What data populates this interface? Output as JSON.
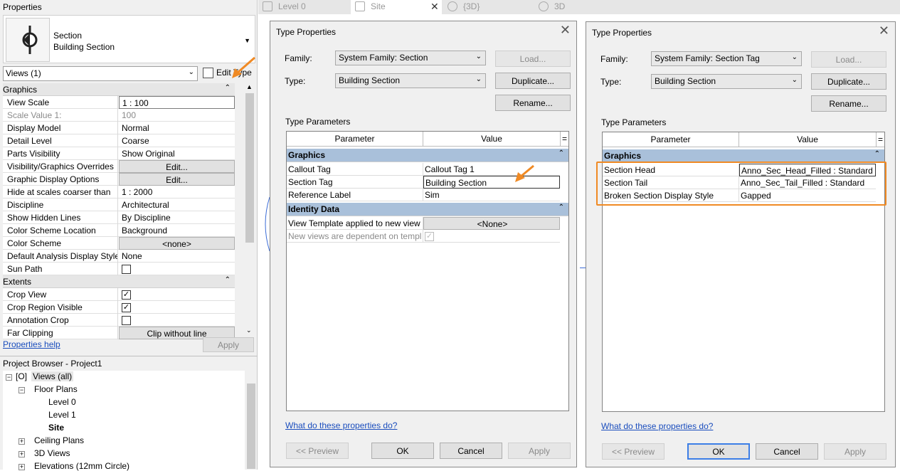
{
  "properties": {
    "title": "Properties",
    "type_line1": "Section",
    "type_line2": "Building Section",
    "views_selector": "Views (1)",
    "edit_type": "Edit Type",
    "help_link": "Properties help",
    "apply": "Apply",
    "groups": [
      {
        "name": "Graphics",
        "rows": [
          {
            "k": "View Scale",
            "v": "1 : 100"
          },
          {
            "k": "Scale Value    1:",
            "v": "100"
          },
          {
            "k": "Display Model",
            "v": "Normal"
          },
          {
            "k": "Detail Level",
            "v": "Coarse"
          },
          {
            "k": "Parts Visibility",
            "v": "Show Original"
          },
          {
            "k": "Visibility/Graphics Overrides",
            "v": "Edit..."
          },
          {
            "k": "Graphic Display Options",
            "v": "Edit..."
          },
          {
            "k": "Hide at scales coarser than",
            "v": "1 : 2000"
          },
          {
            "k": "Discipline",
            "v": "Architectural"
          },
          {
            "k": "Show Hidden Lines",
            "v": "By Discipline"
          },
          {
            "k": "Color Scheme Location",
            "v": "Background"
          },
          {
            "k": "Color Scheme",
            "v": "<none>"
          },
          {
            "k": "Default Analysis Display Style",
            "v": "None"
          },
          {
            "k": "Sun Path",
            "v": ""
          }
        ]
      },
      {
        "name": "Extents",
        "rows": [
          {
            "k": "Crop View",
            "v": ""
          },
          {
            "k": "Crop Region Visible",
            "v": ""
          },
          {
            "k": "Annotation Crop",
            "v": ""
          },
          {
            "k": "Far Clipping",
            "v": "Clip without line"
          }
        ]
      }
    ],
    "checkbox_states": {
      "sun_path": false,
      "crop_view": true,
      "crop_region_visible": true,
      "annotation_crop": false
    }
  },
  "browser": {
    "title": "Project Browser - Project1",
    "nodes": [
      "Views (all)",
      "Floor Plans",
      "Level 0",
      "Level 1",
      "Site",
      "Ceiling Plans",
      "3D Views",
      "Elevations (12mm Circle)"
    ]
  },
  "tabs": [
    "Level 0",
    "Site",
    "{3D}",
    "3D"
  ],
  "dialog1": {
    "title": "Type Properties",
    "family_label": "Family:",
    "family_value": "System Family: Section",
    "type_label": "Type:",
    "type_value": "Building Section",
    "load": "Load...",
    "duplicate": "Duplicate...",
    "rename": "Rename...",
    "type_params": "Type Parameters",
    "col_param": "Parameter",
    "col_value": "Value",
    "col_eq": "=",
    "sections": [
      {
        "name": "Graphics",
        "rows": [
          {
            "k": "Callout Tag",
            "v": "Callout Tag 1"
          },
          {
            "k": "Section Tag",
            "v": "Building Section"
          },
          {
            "k": "Reference Label",
            "v": "Sim"
          }
        ]
      },
      {
        "name": "Identity Data",
        "rows": [
          {
            "k": "View Template applied to new view",
            "v": "<None>"
          },
          {
            "k": "New views are dependent on templ",
            "v": ""
          }
        ]
      }
    ],
    "help": "What do these properties do?",
    "preview": "<< Preview",
    "ok": "OK",
    "cancel": "Cancel",
    "apply": "Apply"
  },
  "dialog2": {
    "title": "Type Properties",
    "family_label": "Family:",
    "family_value": "System Family: Section Tag",
    "type_label": "Type:",
    "type_value": "Building Section",
    "load": "Load...",
    "duplicate": "Duplicate...",
    "rename": "Rename...",
    "type_params": "Type Parameters",
    "col_param": "Parameter",
    "col_value": "Value",
    "col_eq": "=",
    "sections": [
      {
        "name": "Graphics",
        "rows": [
          {
            "k": "Section Head",
            "v": "Anno_Sec_Head_Filled : Standard"
          },
          {
            "k": "Section Tail",
            "v": "Anno_Sec_Tail_Filled : Standard"
          },
          {
            "k": "Broken Section Display Style",
            "v": "Gapped"
          }
        ]
      }
    ],
    "help": "What do these properties do?",
    "preview": "<< Preview",
    "ok": "OK",
    "cancel": "Cancel",
    "apply": "Apply"
  },
  "colors": {
    "accent": "#f08a24",
    "section_header": "#a9c0da",
    "link": "#1a4dbd"
  }
}
